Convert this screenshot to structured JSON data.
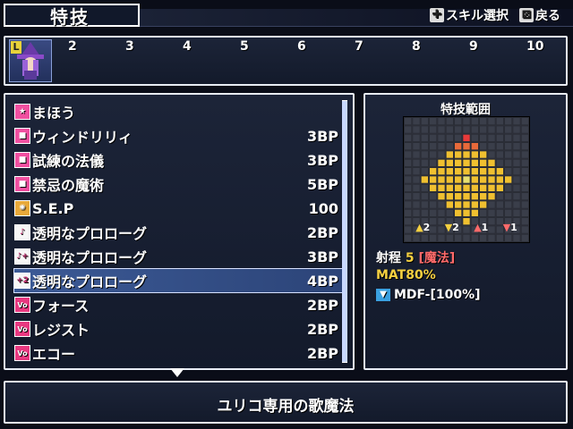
{
  "header": {
    "title": "特技",
    "hint_select": "スキル選択",
    "hint_back": "戻る"
  },
  "party": {
    "leader_badge": "L",
    "slots": [
      "2",
      "3",
      "4",
      "5",
      "6",
      "7",
      "8",
      "9",
      "10"
    ]
  },
  "skills": [
    {
      "icon": "magic-icon",
      "name": "まほう",
      "cost": ""
    },
    {
      "icon": "magic-icon",
      "name": "ウィンドリリィ",
      "cost": "3BP"
    },
    {
      "icon": "magic-icon",
      "name": "試練の法儀",
      "cost": "3BP"
    },
    {
      "icon": "magic-icon",
      "name": "禁忌の魔術",
      "cost": "5BP"
    },
    {
      "icon": "sep-icon",
      "name": "S.E.P",
      "cost": "100"
    },
    {
      "icon": "music-icon",
      "name": "透明なプロローグ",
      "cost": "2BP"
    },
    {
      "icon": "music-plus-icon",
      "name": "透明なプロローグ",
      "cost": "3BP"
    },
    {
      "icon": "music-plus2-icon",
      "name": "透明なプロローグ",
      "cost": "4BP"
    },
    {
      "icon": "vocal-icon",
      "name": "フォース",
      "cost": "2BP"
    },
    {
      "icon": "vocal-icon",
      "name": "レジスト",
      "cost": "2BP"
    },
    {
      "icon": "vocal-icon",
      "name": "エコー",
      "cost": "2BP"
    }
  ],
  "selected_index": 7,
  "range": {
    "title": "特技範囲",
    "height_markers": [
      "2",
      "2",
      "1",
      "1"
    ],
    "range_label": "射程",
    "range_value": "5",
    "range_type": "[魔法]",
    "mat": "MAT80%",
    "mdf": "MDF-[100%]"
  },
  "description": "ユリコ専用の歌魔法",
  "colors": {
    "accent_pink": "#f04fa0",
    "highlight_yellow": "#f5d040",
    "highlight_red": "#ff6a6a",
    "selection": "#3c5a96"
  }
}
